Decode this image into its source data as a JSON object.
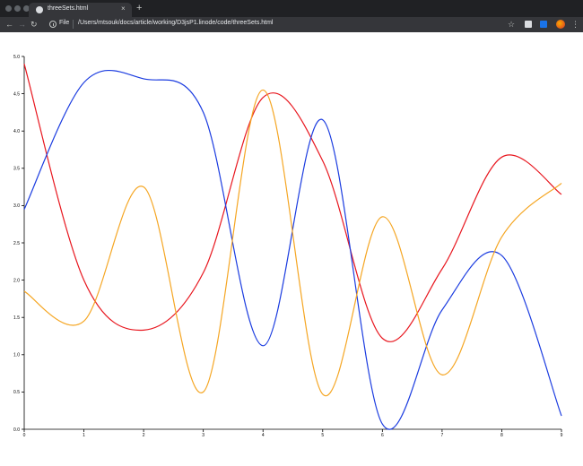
{
  "browser": {
    "tab_title": "threeSets.html",
    "new_tab_symbol": "+",
    "close_symbol": "×",
    "scheme_label": "File",
    "url": "/Users/mtsouk/docs/article/working/D3jsP1.linode/code/threeSets.html"
  },
  "chart_data": {
    "type": "line",
    "curve": "smooth",
    "x": [
      0,
      1,
      2,
      3,
      4,
      5,
      6,
      7,
      8,
      9
    ],
    "xlim": [
      0,
      9
    ],
    "ylim": [
      0,
      5
    ],
    "xticks": [
      "0",
      "1",
      "2",
      "3",
      "4",
      "5",
      "6",
      "7",
      "8",
      "9"
    ],
    "yticks": [
      "0.0",
      "0.5",
      "1.0",
      "1.5",
      "2.0",
      "2.5",
      "3.0",
      "3.5",
      "4.0",
      "4.5",
      "5.0"
    ],
    "grid": false,
    "series": [
      {
        "color": "#e8171f",
        "values": [
          4.9,
          2.0,
          1.33,
          2.1,
          4.45,
          3.6,
          1.22,
          2.15,
          3.65,
          3.15
        ]
      },
      {
        "color": "#1b3ce0",
        "values": [
          2.95,
          4.65,
          4.7,
          4.25,
          1.12,
          4.15,
          0.07,
          1.6,
          2.33,
          0.18
        ]
      },
      {
        "color": "#f5a623",
        "values": [
          1.85,
          1.45,
          3.25,
          0.5,
          4.55,
          0.47,
          2.85,
          0.73,
          2.58,
          3.3
        ]
      }
    ]
  }
}
